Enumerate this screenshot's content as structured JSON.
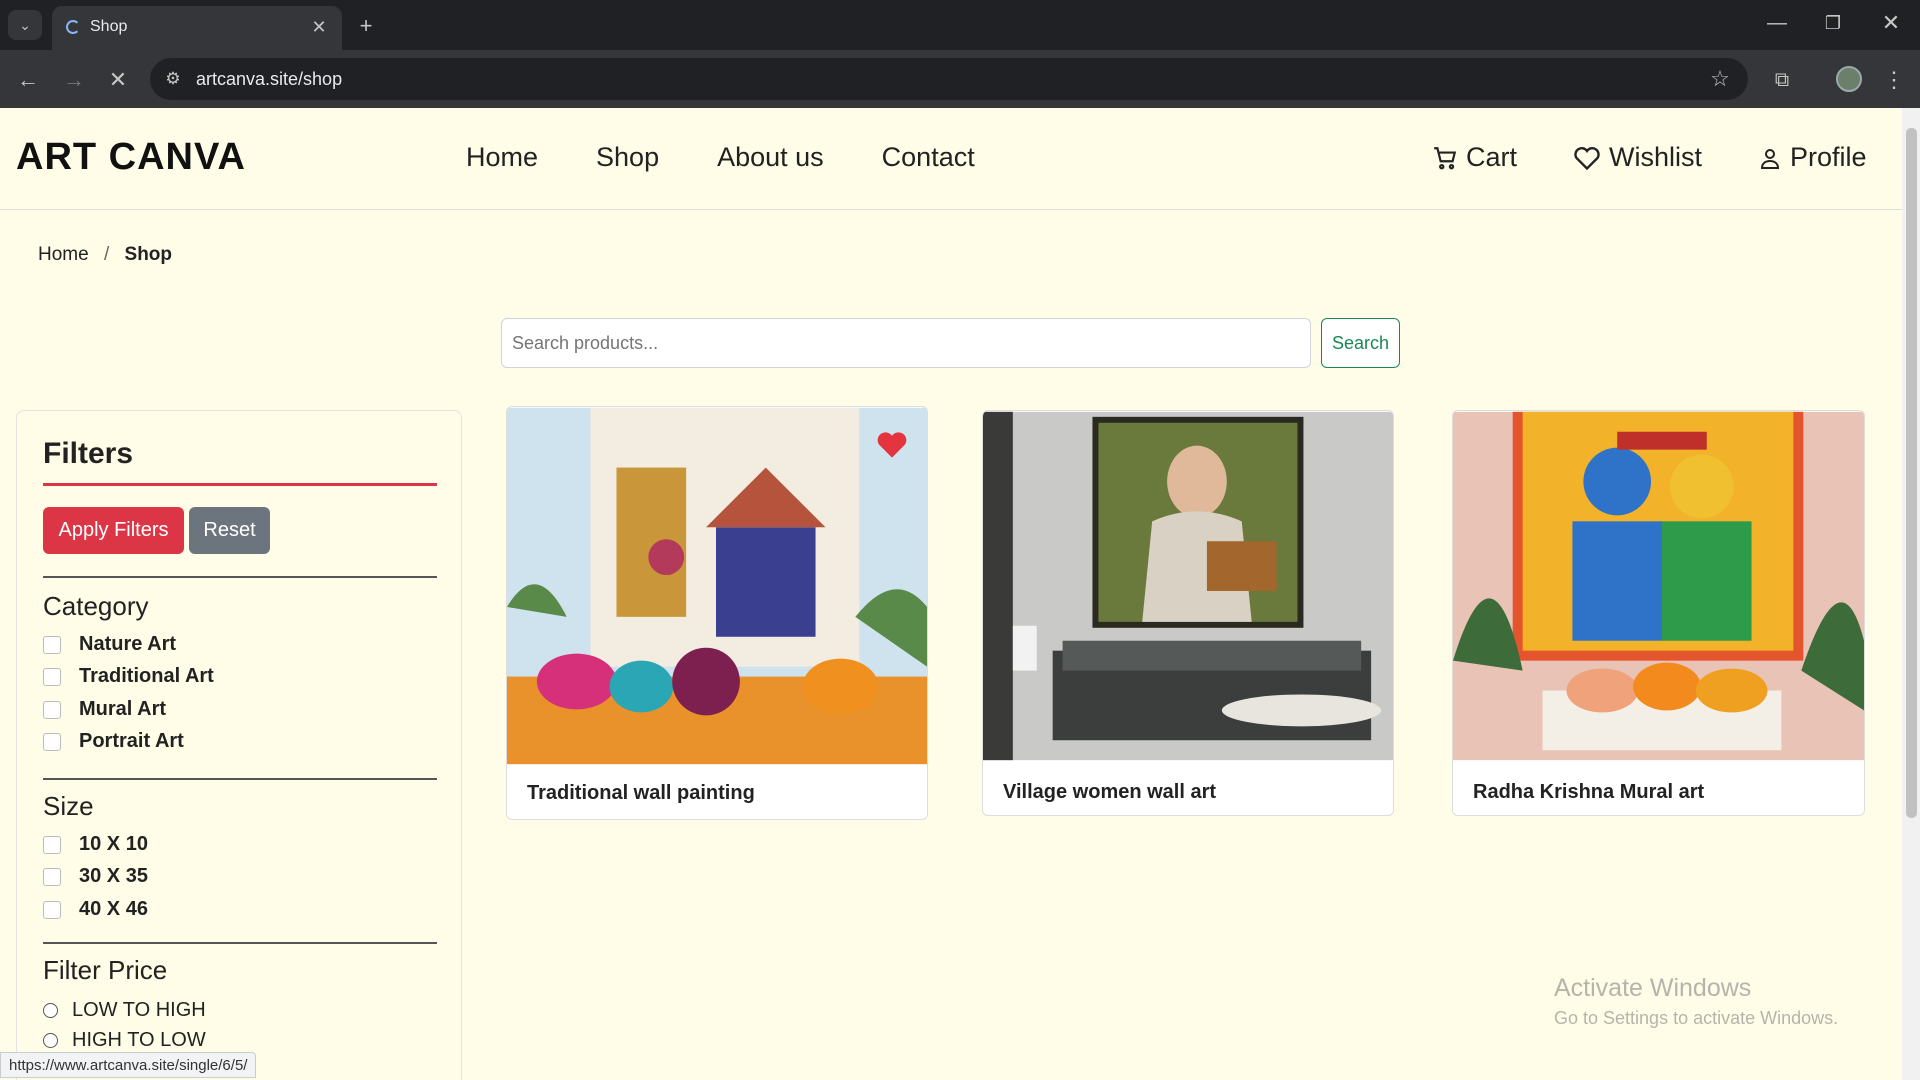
{
  "browser": {
    "tab_title": "Shop",
    "url": "artcanva.site/shop",
    "status_url": "https://www.artcanva.site/single/6/5/"
  },
  "header": {
    "brand": "ART CANVA",
    "nav": [
      "Home",
      "Shop",
      "About us",
      "Contact"
    ],
    "cart": "Cart",
    "wishlist": "Wishlist",
    "profile": "Profile"
  },
  "breadcrumb": {
    "home": "Home",
    "sep": "/",
    "current": "Shop"
  },
  "search": {
    "placeholder": "Search products...",
    "button": "Search"
  },
  "filters": {
    "title": "Filters",
    "apply": "Apply Filters",
    "reset": "Reset",
    "category_title": "Category",
    "categories": [
      "Nature Art",
      "Traditional Art",
      "Mural Art",
      "Portrait Art"
    ],
    "size_title": "Size",
    "sizes": [
      "10 X 10",
      "30 X 35",
      "40 X 46"
    ],
    "price_title": "Filter Price",
    "prices": [
      "LOW TO HIGH",
      "HIGH TO LOW"
    ]
  },
  "products": [
    {
      "name": "Traditional wall painting",
      "wishlisted": true
    },
    {
      "name": "Village women wall art",
      "wishlisted": false
    },
    {
      "name": "Radha Krishna Mural art",
      "wishlisted": false
    }
  ],
  "watermark": {
    "line1": "Activate Windows",
    "line2": "Go to Settings to activate Windows."
  },
  "colors": {
    "accent_red": "#dc3545",
    "search_green": "#198754",
    "page_bg": "#fffde8"
  }
}
